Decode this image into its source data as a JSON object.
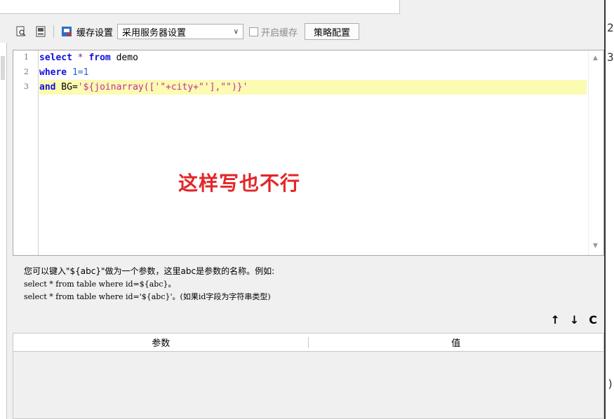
{
  "toolbar": {
    "cache_label": "缓存设置",
    "cache_select_value": "采用服务器设置",
    "enable_cache_label": "开启缓存",
    "policy_button": "策略配置"
  },
  "editor": {
    "line_numbers": [
      "1",
      "2",
      "3"
    ],
    "lines": {
      "l1": {
        "kw1": "select",
        "op": " * ",
        "kw2": "from",
        "rest": " demo"
      },
      "l2": {
        "kw": "where",
        "num": " 1=1"
      },
      "l3": {
        "kw": "and",
        "mid": " BG=",
        "str": "'${joinarray(['\"+city+\"'],\"\")}'"
      }
    },
    "annotation": "这样写也不行"
  },
  "hint": {
    "line1": "您可以键入\"${abc}\"做为一个参数，这里abc是参数的名称。例如:",
    "line2": "select * from table where id=${abc}。",
    "line3": "select * from table where id='${abc}'。(如果id字段为字符串类型)"
  },
  "actions": {
    "up": "↑",
    "down": "↓",
    "refresh": "C"
  },
  "params": {
    "columns": [
      "参数",
      "值"
    ]
  },
  "colors": {
    "keyword": "#1111dd",
    "string": "#c030a0",
    "annotation": "#e2262a",
    "highlight_line": "#fbfbb2"
  }
}
